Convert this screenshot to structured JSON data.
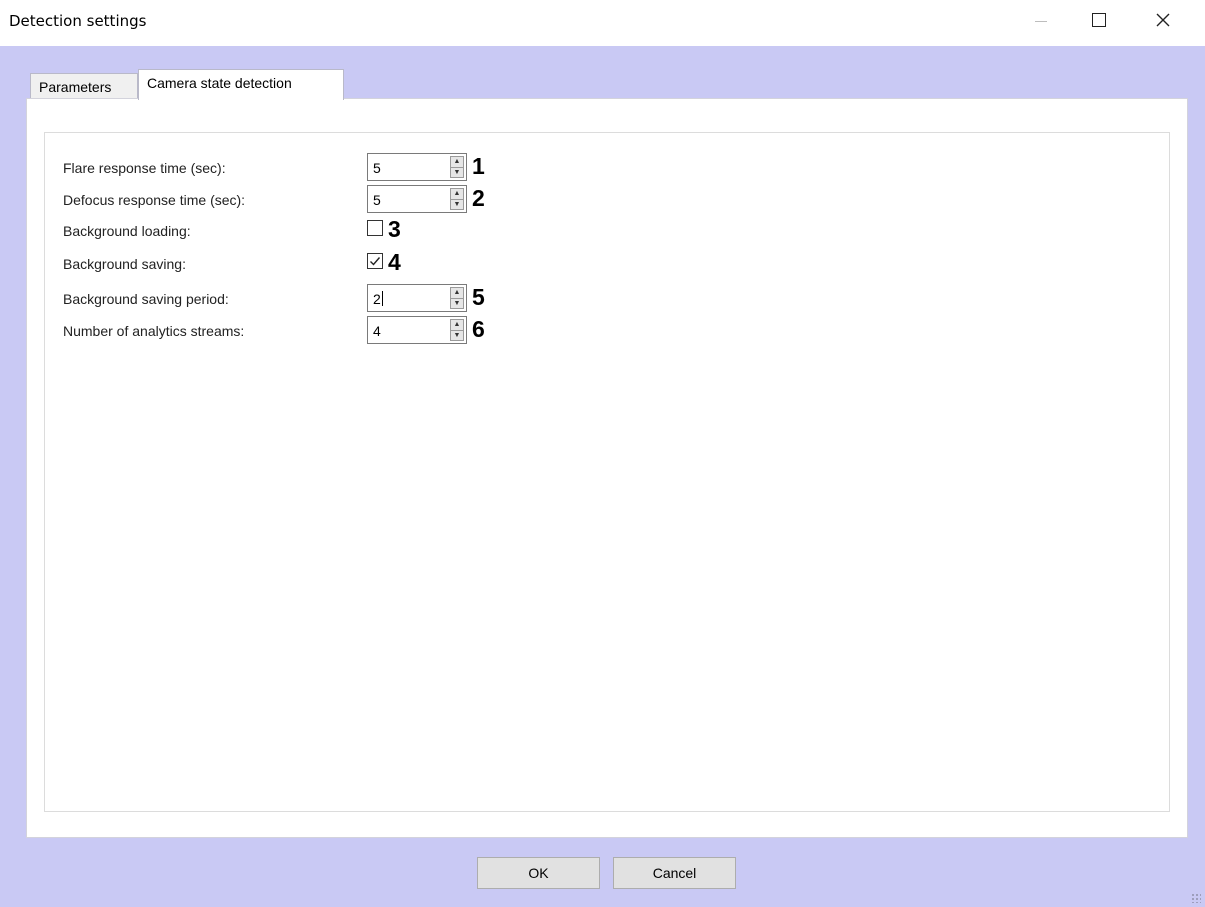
{
  "window": {
    "title": "Detection settings",
    "minimize_glyph": "—",
    "close_glyph": "✕"
  },
  "tabs": [
    {
      "label": "Parameters",
      "active": false
    },
    {
      "label": "Camera state detection",
      "active": true
    }
  ],
  "fields": [
    {
      "label": "Flare response time (sec):",
      "type": "spinner",
      "value": "5",
      "marker": "1"
    },
    {
      "label": "Defocus response time (sec):",
      "type": "spinner",
      "value": "5",
      "marker": "2"
    },
    {
      "label": "Background loading:",
      "type": "checkbox",
      "checked": false,
      "marker": "3"
    },
    {
      "label": "Background saving:",
      "type": "checkbox",
      "checked": true,
      "marker": "4"
    },
    {
      "label": "Background saving period:",
      "type": "spinner",
      "value": "2",
      "marker": "5"
    },
    {
      "label": "Number of analytics streams:",
      "type": "spinner",
      "value": "4",
      "marker": "6"
    }
  ],
  "buttons": {
    "ok_label": "OK",
    "cancel_label": "Cancel"
  },
  "icons": {
    "spin_up": "▲",
    "spin_down": "▼"
  },
  "colors": {
    "client_background": "#c9c9f4",
    "panel_background": "#ffffff"
  }
}
